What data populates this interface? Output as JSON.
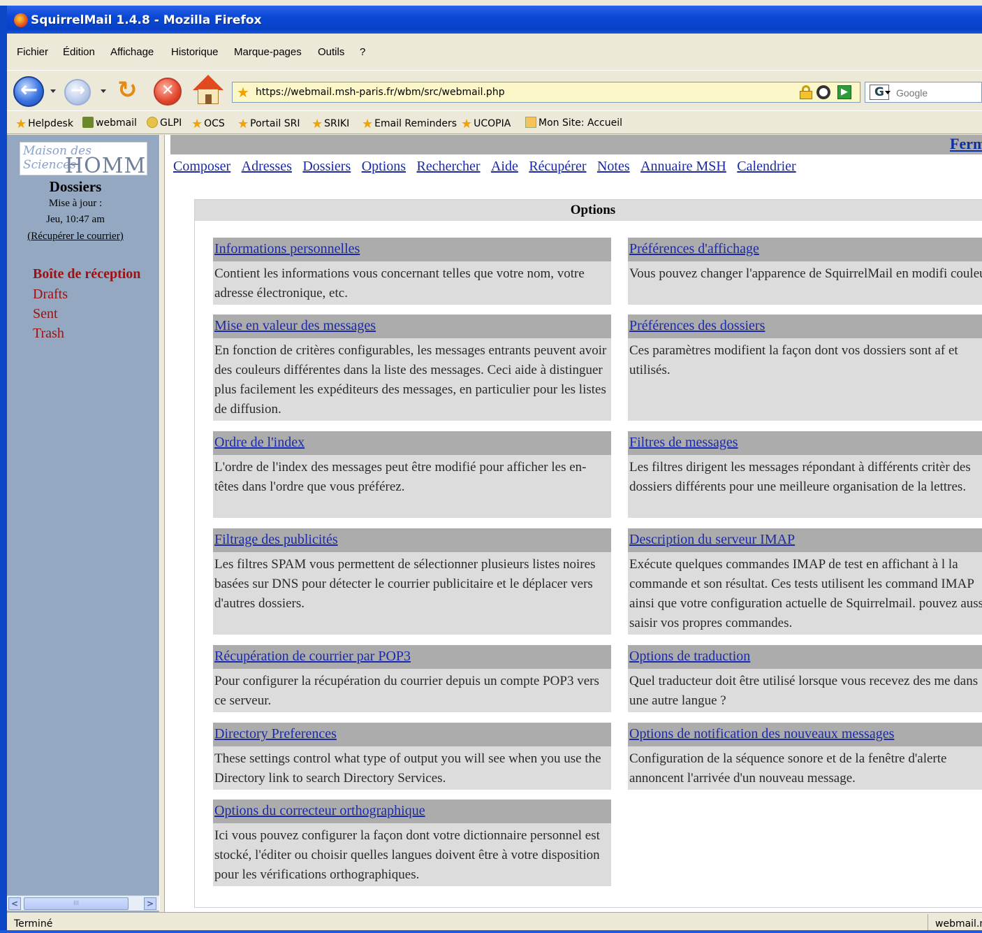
{
  "window": {
    "title": "SquirrelMail 1.4.8 - Mozilla Firefox"
  },
  "menu": [
    "Fichier",
    "Édition",
    "Affichage",
    "Historique",
    "Marque-pages",
    "Outils",
    "?"
  ],
  "address_bar": {
    "url": "https://webmail.msh-paris.fr/wbm/src/webmail.php"
  },
  "search_box": {
    "placeholder": "Google",
    "engine_letter": "G"
  },
  "bookmarks": [
    "Helpdesk",
    "webmail",
    "GLPI",
    "OCS",
    "Portail SRI",
    "SRIKI",
    "Email Reminders",
    "UCOPIA",
    "Mon Site: Accueil"
  ],
  "sidebar": {
    "logo_top": "Maison des Sciences",
    "logo_bottom": "HOMME",
    "title": "Dossiers",
    "updated_label": "Mise à jour :",
    "updated_time": "Jeu, 10:47 am",
    "refresh_link": "(Récupérer le courrier)",
    "folders": [
      "Boîte de réception",
      "Drafts",
      "Sent",
      "Trash"
    ],
    "scroll_thumb": "III"
  },
  "main": {
    "signout": "Ferm",
    "nav": [
      "Composer",
      "Adresses",
      "Dossiers",
      "Options",
      "Rechercher",
      "Aide",
      "Récupérer",
      "Notes",
      "Annuaire MSH",
      "Calendrier"
    ],
    "options_title": "Options",
    "options_left": [
      {
        "title": "Informations personnelles",
        "desc": "Contient les informations vous concernant telles que votre nom, votre adresse électronique, etc."
      },
      {
        "title": "Mise en valeur des messages",
        "desc": "En fonction de critères configurables, les messages entrants peuvent avoir des couleurs différentes dans la liste des messages. Ceci aide à distinguer plus facilement les expéditeurs des messages, en particulier pour les listes de diffusion."
      },
      {
        "title": "Ordre de l'index",
        "desc": "L'ordre de l'index des messages peut être modifié pour afficher les en-têtes dans l'ordre que vous préférez."
      },
      {
        "title": "Filtrage des publicités",
        "desc": "Les filtres SPAM vous permettent de sélectionner plusieurs listes noires basées sur DNS pour détecter le courrier publicitaire et le déplacer vers d'autres dossiers."
      },
      {
        "title": "Récupération de courrier par POP3",
        "desc": "Pour configurer la récupération du courrier depuis un compte POP3 vers ce serveur."
      },
      {
        "title": "Directory Preferences",
        "desc": "These settings control what type of output you will see when you use the Directory link to search Directory Services."
      },
      {
        "title": "Options du correcteur orthographique",
        "desc": "Ici vous pouvez configurer la façon dont votre dictionnaire personnel est stocké, l'éditer ou choisir quelles langues doivent être à votre disposition pour les vérifications orthographiques."
      }
    ],
    "options_right": [
      {
        "title": "Préférences d'affichage",
        "desc": "Vous pouvez changer l'apparence de SquirrelMail en modifi couleurs, la langue ou d'autres paramètres."
      },
      {
        "title": "Préférences des dossiers",
        "desc": "Ces paramètres modifient la façon dont vos dossiers sont af et utilisés."
      },
      {
        "title": "Filtres de messages",
        "desc": "Les filtres dirigent les messages répondant à différents critèr des dossiers différents pour une meilleure organisation de la lettres."
      },
      {
        "title": "Description du serveur IMAP",
        "desc": "Exécute quelques commandes IMAP de test en affichant à l la commande et son résultat. Ces tests utilisent les command IMAP ainsi que votre configuration actuelle de Squirrelmail. pouvez aussi saisir vos propres commandes."
      },
      {
        "title": "Options de traduction",
        "desc": "Quel traducteur doit être utilisé lorsque vous recevez des me dans une autre langue ?"
      },
      {
        "title": "Options de notification des nouveaux messages",
        "desc": "Configuration de la séquence sonore et de la fenêtre d'alerte annoncent l'arrivée d'un nouveau message."
      }
    ]
  },
  "status": {
    "text": "Terminé",
    "right": "webmail.m"
  },
  "colors": {
    "link": "#1b2aa8",
    "folder": "#a01010",
    "sidebar": "#94a9c1",
    "option_head": "#acacac",
    "option_body": "#dcdcdc"
  }
}
